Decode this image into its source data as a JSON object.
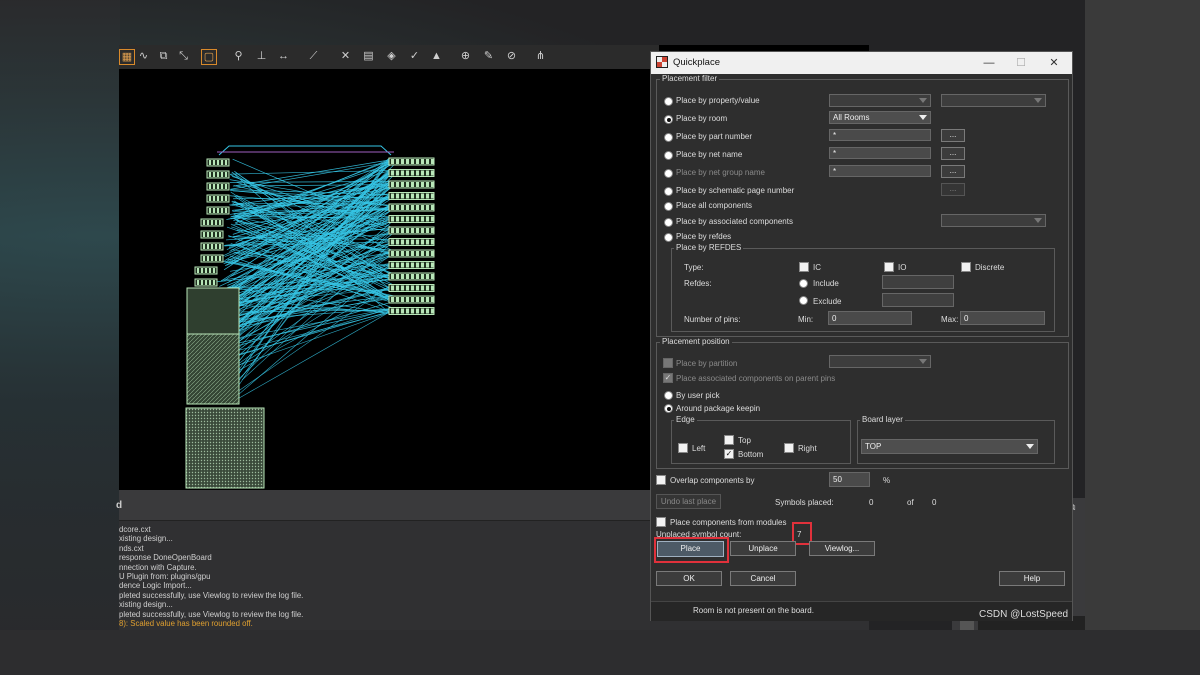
{
  "dialog": {
    "title": "Quickplace",
    "placement_filter": {
      "label": "Placement filter",
      "options": [
        "Place by property/value",
        "Place by room",
        "Place by part number",
        "Place by net name",
        "Place by net group name",
        "Place by schematic page number",
        "Place all components",
        "Place by associated components",
        "Place by refdes"
      ],
      "selected": "Place by room",
      "room_value": "All Rooms",
      "part_number_value": "*",
      "net_name_value": "*",
      "net_group_value": "*",
      "browse_label": "...",
      "refdes_group": {
        "label": "Place by REFDES",
        "type_label": "Type:",
        "ic_label": "IC",
        "io_label": "IO",
        "discrete_label": "Discrete",
        "refdes_label": "Refdes:",
        "include_label": "Include",
        "exclude_label": "Exclude",
        "pins_label": "Number of pins:",
        "min_label": "Min:",
        "min_value": "0",
        "max_label": "Max:",
        "max_value": "0"
      }
    },
    "placement_position": {
      "label": "Placement position",
      "by_partition_label": "Place by partition",
      "associated_parent_label": "Place associated components on parent pins",
      "by_user_pick_label": "By user pick",
      "around_keepin_label": "Around package keepin",
      "edge": {
        "label": "Edge",
        "left": "Left",
        "top": "Top",
        "bottom": "Bottom",
        "right": "Right",
        "bottom_checked": true
      },
      "board_layer": {
        "label": "Board layer",
        "value": "TOP"
      }
    },
    "overlap_label": "Overlap components by",
    "overlap_value": "50",
    "overlap_unit": "%",
    "undo_last_place_label": "Undo last place",
    "symbols_placed_label": "Symbols placed:",
    "symbols_placed_value": "0",
    "of_label": "of",
    "of_value": "0",
    "place_from_modules_label": "Place components from modules",
    "unplaced_label": "Unplaced symbol count:",
    "unplaced_value": "7",
    "buttons": {
      "place": "Place",
      "unplace": "Unplace",
      "viewlog": "Viewlog...",
      "ok": "OK",
      "cancel": "Cancel",
      "help": "Help"
    },
    "status_text": "Room is not present on the board."
  },
  "log": {
    "header": "d",
    "lines": [
      "dcore.cxt",
      "xisting design...",
      "nds.cxt",
      " response DoneOpenBoard",
      "nnection with Capture.",
      "U Plugin from: plugins/gpu",
      "dence Logic Import...",
      "pleted successfully, use Viewlog to review the log file.",
      "xisting design...",
      "pleted successfully, use Viewlog to review the log file.",
      "8): Scaled value has been rounded off."
    ],
    "warning_line_index": 10
  },
  "colors": {
    "ratsnest": "#36c6e6",
    "component": "#b8e6b8",
    "highlight_box": "#e0313b",
    "warning_text": "#e0a030"
  },
  "watermark": "CSDN @LostSpeed"
}
